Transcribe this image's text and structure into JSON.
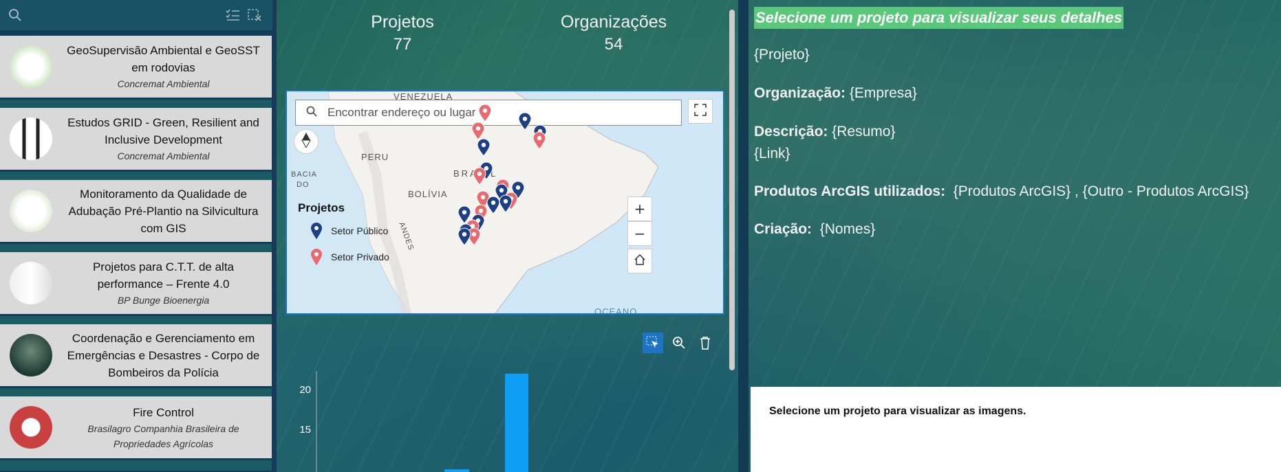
{
  "search_placeholder": "",
  "list": {
    "items": [
      {
        "title": "GeoSupervisão Ambiental e GeoSST em rodovias",
        "org": "Concremat Ambiental"
      },
      {
        "title": "Estudos GRID - Green, Resilient and Inclusive Development",
        "org": "Concremat Ambiental"
      },
      {
        "title": "Monitoramento da Qualidade de Adubação Pré-Plantio na Silvicultura com GIS",
        "org": ""
      },
      {
        "title": "Projetos para C.T.T. de alta performance – Frente 4.0",
        "org": "BP Bunge Bioenergia"
      },
      {
        "title": "Coordenação e Gerenciamento em Emergências e Desastres - Corpo de Bombeiros da Polícia",
        "org": ""
      },
      {
        "title": "Fire Control",
        "org": "Brasilagro Companhia Brasileira de Propriedades Agrícolas"
      }
    ]
  },
  "stats": {
    "projects_label": "Projetos",
    "projects_value": "77",
    "orgs_label": "Organizações",
    "orgs_value": "54"
  },
  "map": {
    "search_placeholder": "Encontrar endereço ou lugar",
    "labels": {
      "venezuela": "VENEZUELA",
      "peru": "PERU",
      "brasil": "BRASIL",
      "bolivia": "BOLÍVIA",
      "bacia": "BACIA",
      "do": "DO",
      "andes": "ANDES",
      "oceano": "OCEANO"
    },
    "legend": {
      "title": "Projetos",
      "public": "Setor Público",
      "private": "Setor Privado"
    },
    "colors": {
      "public": "#1c3f86",
      "private": "#e8696e"
    }
  },
  "chart_data": {
    "type": "bar",
    "ylabel": "",
    "yticks": [
      15,
      20
    ],
    "bars": [
      {
        "x": 1,
        "value": 10
      },
      {
        "x": 2,
        "value": 22
      }
    ],
    "color": "#0f9df6"
  },
  "details": {
    "headline": "Selecione um projeto para visualizar seus detalhes",
    "project": "{Projeto}",
    "org_label": "Organização:",
    "org_value": "{Empresa}",
    "desc_label": "Descrição:",
    "desc_value": "{Resumo}",
    "link": "{Link}",
    "products_label": "Produtos ArcGIS utilizados:",
    "products_value": "{Produtos ArcGIS} , {Outro - Produtos ArcGIS}",
    "creation_label": "Criação:",
    "creation_value": "{Nomes}",
    "images_msg": "Selecione um projeto para visualizar as imagens."
  }
}
